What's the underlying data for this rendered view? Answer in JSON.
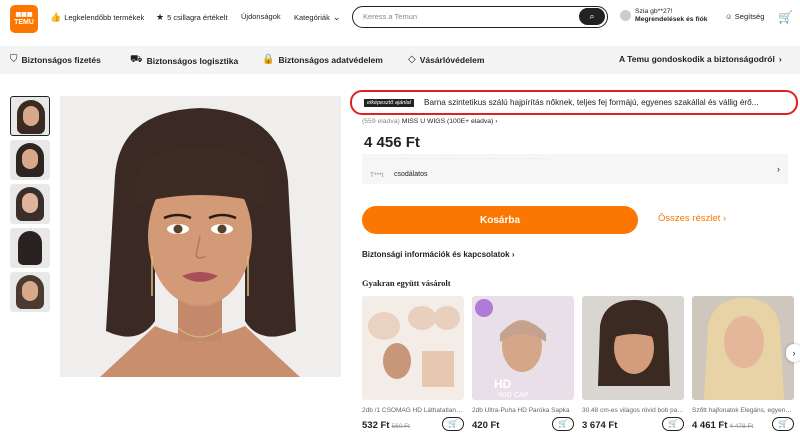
{
  "header": {
    "logo_text": "TEMU",
    "logo_top": "2,0,0,0",
    "nav": [
      {
        "label": "Legkelendőbb termékek",
        "icon": "thumbs-up-icon"
      },
      {
        "label": "5 csillagra értékelt",
        "icon": "star-badge-icon"
      },
      {
        "label": "Újdonságok"
      },
      {
        "label": "Kategóriák",
        "icon": "chevron-down-icon"
      }
    ],
    "search_placeholder": "Keress a Temun",
    "greeting": "Szia gb**27!",
    "account_label": "Megrendelések és fiók",
    "help_label": "Segítség",
    "accent_color": "#fb7701"
  },
  "trust": {
    "items": [
      "Biztonságos fizetés",
      "Biztonságos logisztika",
      "Biztonságos adatvédelem",
      "Vásárlóvédelem"
    ],
    "right": "A Temu gondoskodik a biztonságodról"
  },
  "product": {
    "badge": "elképesztő ajánlat",
    "title": "Barna szintetikus szálú hajpírítás nőknek, teljes fej formájú, egyenes szakállal és vállig érő...",
    "sold": "(559 eladva)",
    "store": "MISS U WIGS (100E+ eladva)",
    "price": "4 456 Ft",
    "review_user": "T***t",
    "review_text": "csodálatos",
    "add_to_cart": "Kosárba",
    "details_link": "Összes részlet",
    "safety_link": "Biztonsági információk és kapcsolatok",
    "fbt_title": "Gyakran együtt vásárolt"
  },
  "related": [
    {
      "name": "2db /1 CSOMAG HD Láthatatlan Parókasapka",
      "price": "532 Ft",
      "old_price": "560 Ft"
    },
    {
      "name": "2db Ultra-Puha HD Paróka Sapka",
      "price": "420 Ft",
      "old_price": ""
    },
    {
      "name": "30.48 cm-es világos rövid bob paróka",
      "price": "3 674 Ft",
      "old_price": ""
    },
    {
      "name": "Szőtt hajfonatok Elegáns, egyenes paróka",
      "price": "4 461 Ft",
      "old_price": "4 478 Ft"
    }
  ],
  "related_overlay": {
    "hd_text": "HD",
    "wig_cap_text": "WIG CAP"
  }
}
